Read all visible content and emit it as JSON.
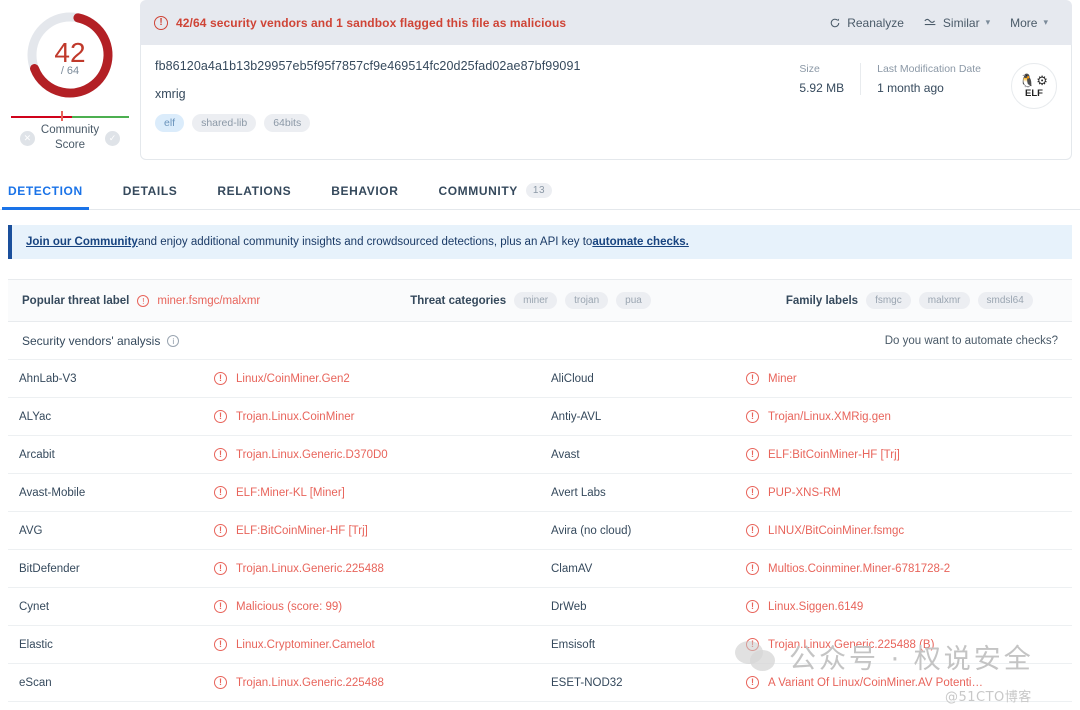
{
  "gauge": {
    "detections": "42",
    "total": "/ 64",
    "community_label_line1": "Community",
    "community_label_line2": "Score",
    "left_icon": "circle-x-icon",
    "right_icon": "circle-check-icon",
    "accent_red": "#c0392b",
    "track_gray": "#e4e7ec"
  },
  "alert": {
    "icon": "exclamation-circle-icon",
    "text": "42/64 security vendors and 1 sandbox flagged this file as malicious",
    "color": "#cf4436",
    "actions": [
      {
        "icon": "reanalyze-icon",
        "label": "Reanalyze",
        "caret": ""
      },
      {
        "icon": "similar-icon",
        "label": "Similar",
        "caret": "⌄"
      },
      {
        "icon": "",
        "label": "More",
        "caret": "⌄"
      }
    ]
  },
  "file": {
    "hash": "fb86120a4a1b13b29957eb5f95f7857cf9e469514fc20d25fad02ae87bf99091",
    "name": "xmrig",
    "tags": [
      "elf",
      "shared-lib",
      "64bits"
    ],
    "meta": [
      {
        "label": "Size",
        "value": "5.92 MB"
      },
      {
        "label": "Last Modification Date",
        "value": "1 month ago"
      }
    ],
    "filetype_icon": "linux-tux-gear-icon",
    "filetype_label": "ELF"
  },
  "tabs": [
    {
      "label": "DETECTION",
      "badge": "",
      "active": true
    },
    {
      "label": "DETAILS",
      "badge": "",
      "active": false
    },
    {
      "label": "RELATIONS",
      "badge": "",
      "active": false
    },
    {
      "label": "BEHAVIOR",
      "badge": "",
      "active": false
    },
    {
      "label": "COMMUNITY",
      "badge": "13",
      "active": false
    }
  ],
  "join_banner": {
    "link1": "Join our Community",
    "middle": " and enjoy additional community insights and crowdsourced detections, plus an API key to ",
    "link2": "automate checks."
  },
  "threat": {
    "popular_label_title": "Popular threat label",
    "popular_label_value": "miner.fsmgc/malxmr",
    "popular_label_icon": "red-info-icon",
    "categories_title": "Threat categories",
    "categories": [
      "miner",
      "trojan",
      "pua"
    ],
    "family_title": "Family labels",
    "family": [
      "fsmgc",
      "malxmr",
      "smdsl64"
    ]
  },
  "vendors_header": {
    "title": "Security vendors' analysis",
    "info_icon": "info-circle-icon",
    "right_link": "Do you want to automate checks?"
  },
  "vendors": [
    {
      "name": "AhnLab-V3",
      "result": "Linux/CoinMiner.Gen2"
    },
    {
      "name": "AliCloud",
      "result": "Miner"
    },
    {
      "name": "ALYac",
      "result": "Trojan.Linux.CoinMiner"
    },
    {
      "name": "Antiy-AVL",
      "result": "Trojan/Linux.XMRig.gen"
    },
    {
      "name": "Arcabit",
      "result": "Trojan.Linux.Generic.D370D0"
    },
    {
      "name": "Avast",
      "result": "ELF:BitCoinMiner-HF [Trj]"
    },
    {
      "name": "Avast-Mobile",
      "result": "ELF:Miner-KL [Miner]"
    },
    {
      "name": "Avert Labs",
      "result": "PUP-XNS-RM"
    },
    {
      "name": "AVG",
      "result": "ELF:BitCoinMiner-HF [Trj]"
    },
    {
      "name": "Avira (no cloud)",
      "result": "LINUX/BitCoinMiner.fsmgc"
    },
    {
      "name": "BitDefender",
      "result": "Trojan.Linux.Generic.225488"
    },
    {
      "name": "ClamAV",
      "result": "Multios.Coinminer.Miner-6781728-2"
    },
    {
      "name": "Cynet",
      "result": "Malicious (score: 99)"
    },
    {
      "name": "DrWeb",
      "result": "Linux.Siggen.6149"
    },
    {
      "name": "Elastic",
      "result": "Linux.Cryptominer.Camelot"
    },
    {
      "name": "Emsisoft",
      "result": "Trojan.Linux.Generic.225488 (B)"
    },
    {
      "name": "eScan",
      "result": "Trojan.Linux.Generic.225488"
    },
    {
      "name": "ESET-NOD32",
      "result": "A Variant Of Linux/CoinMiner.AV Potenti…"
    }
  ],
  "watermark": {
    "text": "公众号 · 权说安全",
    "handle": "@51CTO博客",
    "icon": "wechat-bubbles-icon"
  }
}
